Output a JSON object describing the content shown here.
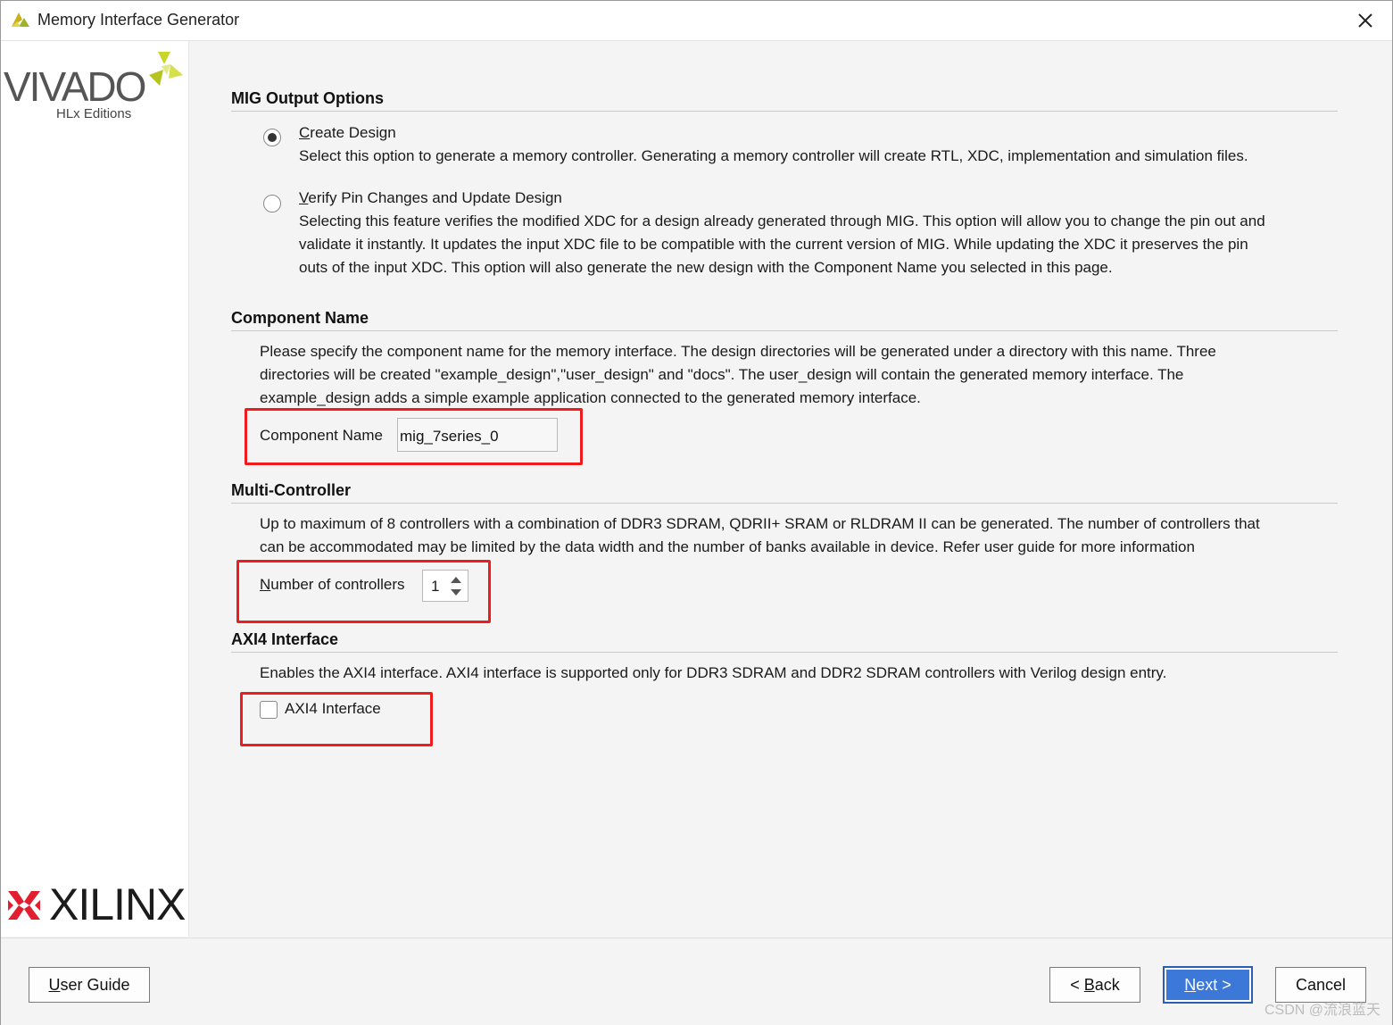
{
  "window": {
    "title": "Memory Interface Generator"
  },
  "branding": {
    "vivado_text": "VIVADO",
    "vivado_sub": "HLx Editions",
    "xilinx_text": "XILINX",
    "accent_yellow": "#c8d62b",
    "xilinx_red": "#e21d2f"
  },
  "sections": {
    "mig": {
      "title": "MIG Output Options",
      "create_label_accel": "C",
      "create_label_rest": "reate Design",
      "create_desc": "Select this option to generate a memory controller. Generating a memory controller will create RTL, XDC, implementation and simulation files.",
      "verify_label_accel": "V",
      "verify_label_rest": "erify Pin Changes and Update Design",
      "verify_desc_1": "Selecting this feature verifies the modified XDC for a design already generated through MIG. This option will allow you to change the pin out and",
      "verify_desc_2": "validate it instantly. It updates the input XDC file to be compatible with the current version of MIG. While updating the XDC it preserves the pin",
      "verify_desc_3": "outs of the input XDC. This option will also generate the new design with the Component Name you selected in this page.",
      "selected": "create"
    },
    "component": {
      "title": "Component Name",
      "desc_1": "Please specify the component name for the memory interface. The design directories will be generated under a directory with this name. Three",
      "desc_2": "directories will be created \"example_design\",\"user_design\" and \"docs\". The user_design will contain the generated memory interface. The",
      "desc_3": "example_design adds a simple example application connected to the generated memory interface.",
      "field_label": "Component Name",
      "field_value": "mig_7series_0"
    },
    "multi": {
      "title": "Multi-Controller",
      "desc_1": "Up to maximum of 8 controllers with a combination of DDR3 SDRAM, QDRII+ SRAM or RLDRAM II can be generated. The number of controllers that",
      "desc_2": "can be accommodated may be limited by the data width and the number of banks available in device. Refer user guide for more information",
      "field_label_accel": "N",
      "field_label_rest": "umber of controllers",
      "field_value": "1"
    },
    "axi": {
      "title": "AXI4 Interface",
      "desc": "Enables the AXI4 interface. AXI4 interface is supported only for DDR3 SDRAM and DDR2 SDRAM controllers with Verilog design entry.",
      "checkbox_label": "AXI4 Interface",
      "checked": false
    }
  },
  "footer": {
    "user_guide_accel": "U",
    "user_guide_rest": "ser Guide",
    "back_prefix": "< ",
    "back_accel": "B",
    "back_rest": "ack",
    "next_accel": "N",
    "next_rest": "ext >",
    "cancel_label": "Cancel"
  },
  "watermark": "CSDN @流浪蓝天",
  "highlight_color": "#ee1c1c"
}
